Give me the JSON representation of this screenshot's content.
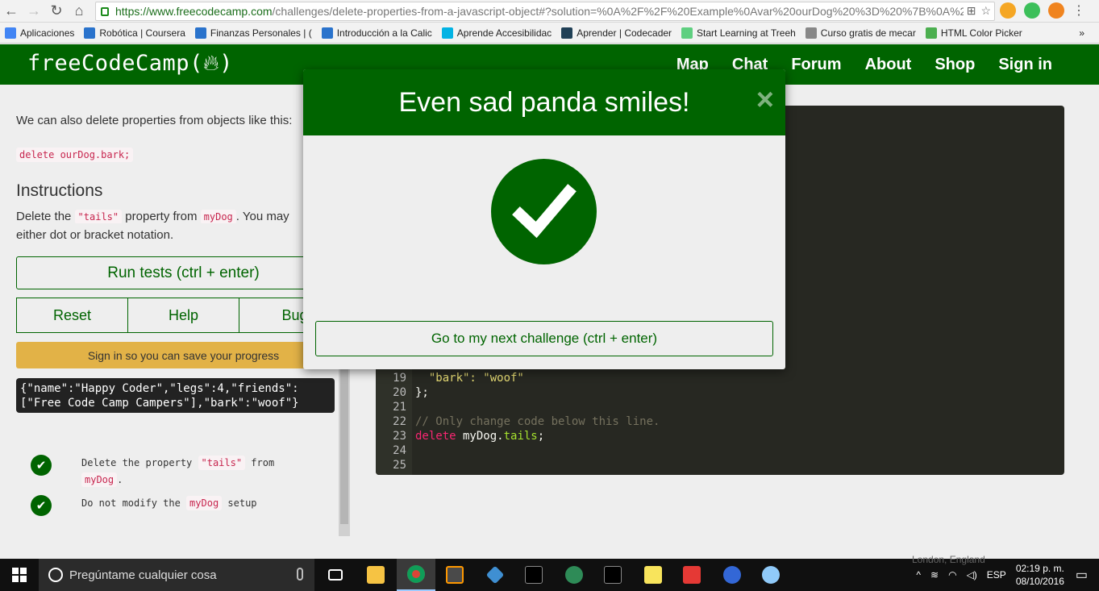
{
  "browser": {
    "url_host": "https://www.freecodecamp.com",
    "url_path": "/challenges/delete-properties-from-a-javascript-object#?solution=%0A%2F%2F%20Example%0Avar%20ourDog%20%3D%20%7B%0A%20",
    "bookmarks": [
      {
        "label": "Aplicaciones",
        "icon": "apps-grid-icon",
        "color": "#4285f4"
      },
      {
        "label": "Robótica | Coursera",
        "icon": "coursera-icon",
        "color": "#2a73cc"
      },
      {
        "label": "Finanzas Personales | (",
        "icon": "coursera-icon",
        "color": "#2a73cc"
      },
      {
        "label": "Introducción a la Calic",
        "icon": "coursera-icon",
        "color": "#2a73cc"
      },
      {
        "label": "Aprende Accesibilidac",
        "icon": "udacity-icon",
        "color": "#02b3e4"
      },
      {
        "label": "Aprender | Codecader",
        "icon": "codecademy-icon",
        "color": "#204056"
      },
      {
        "label": "Start Learning at Treeh",
        "icon": "treehouse-icon",
        "color": "#5fcf80"
      },
      {
        "label": "Curso gratis de mecar",
        "icon": "page-icon",
        "color": "#888888"
      },
      {
        "label": "HTML Color Picker",
        "icon": "w3schools-icon",
        "color": "#4caf50"
      }
    ],
    "more_bookmarks": "»"
  },
  "fcc_nav": {
    "logo_text": "freeCodeCamp(",
    "logo_close": ")",
    "links": [
      "Map",
      "Chat",
      "Forum",
      "About",
      "Shop",
      "Sign in"
    ]
  },
  "challenge": {
    "intro_text": "We can also delete properties from objects like this:",
    "example_code": "delete ourDog.bark;",
    "instructions_heading": "Instructions",
    "instr_part1": "Delete the ",
    "instr_code1": "\"tails\"",
    "instr_part2": " property from ",
    "instr_code2": "myDog",
    "instr_part3": ". You may",
    "instr_line2": "either dot or bracket notation.",
    "run_tests_label": "Run tests (ctrl + enter)",
    "reset_label": "Reset",
    "help_label": "Help",
    "bug_label": "Bug",
    "signin_notice": "Sign in so you can save your progress",
    "output_line1": "{\"name\":\"Happy Coder\",\"legs\":4,\"friends\":",
    "output_line2": "[\"Free Code Camp Campers\"],\"bark\":\"woof\"}",
    "tests": [
      {
        "pre": "Delete the property ",
        "code": "\"tails\"",
        "mid": " from",
        "code2": "myDog",
        "post": "."
      },
      {
        "pre": "Do not modify the ",
        "code": "myDog",
        "mid": " setup",
        "code2": "",
        "post": ""
      }
    ]
  },
  "editor": {
    "lines": [
      {
        "n": "19",
        "text": "  \"bark\": \"woof\""
      },
      {
        "n": "20",
        "text": "};"
      },
      {
        "n": "21",
        "text": ""
      },
      {
        "n": "22",
        "text": "// Only change code below this line."
      },
      {
        "n": "23",
        "kw": "delete",
        "obj": " myDog",
        "dot": ".",
        "prop": "tails",
        "end": ";"
      },
      {
        "n": "24",
        "text": ""
      },
      {
        "n": "25",
        "text": ""
      }
    ]
  },
  "modal": {
    "title": "Even sad panda smiles!",
    "close": "×",
    "next_button": "Go to my next challenge (ctrl + enter)"
  },
  "taskbar": {
    "search_placeholder": "Pregúntame cualquier cosa",
    "language": "ESP",
    "time": "02:19 p. m.",
    "date": "08/10/2016",
    "weather_location": "London, England"
  },
  "colors": {
    "fcc_green": "#006400",
    "signin_yellow": "#e2b247",
    "editor_bg": "#272822"
  }
}
